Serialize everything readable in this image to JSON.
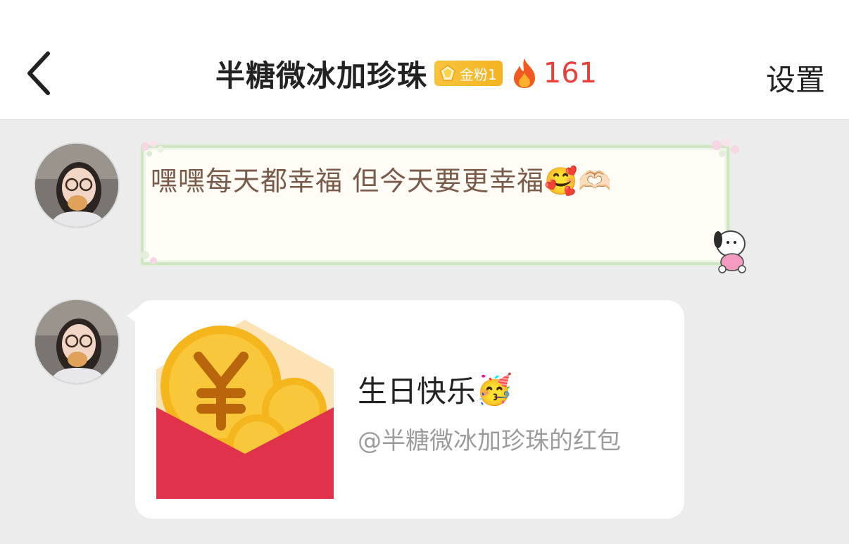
{
  "header": {
    "title": "半糖微冰加珍珠",
    "fan_badge": "金粉1",
    "fire_count": "161",
    "settings_label": "设置"
  },
  "messages": [
    {
      "type": "text",
      "text": "嘿嘿每天都幸福 但今天要更幸福🥰🫶🏻"
    },
    {
      "type": "red_packet",
      "title": "生日快乐",
      "title_emoji": "🥳",
      "subtitle": "@半糖微冰加珍珠的红包"
    }
  ],
  "colors": {
    "fire": "#e8403a",
    "badge": "#f4b322",
    "packet_red": "#e0324a",
    "coin": "#f5b51c"
  }
}
